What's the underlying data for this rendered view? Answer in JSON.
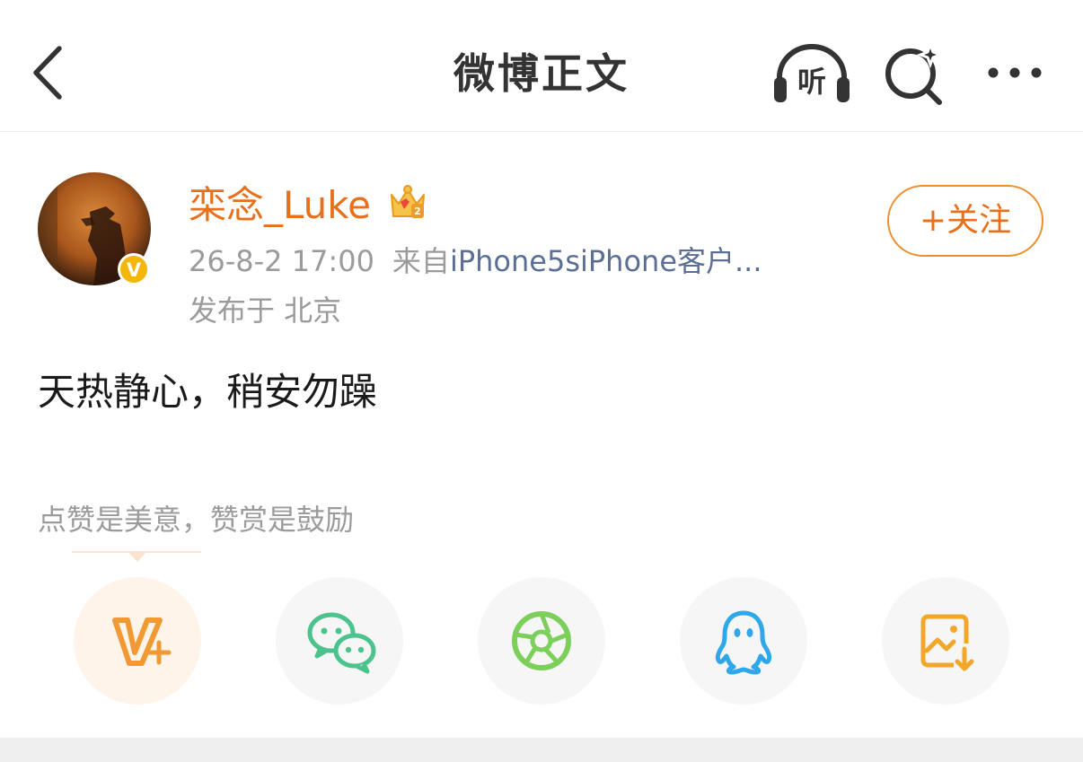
{
  "header": {
    "title": "微博正文",
    "listen_label": "听",
    "back_icon": "chevron-left-icon",
    "search_icon": "search-sparkle-icon",
    "more_icon": "more-dots-icon"
  },
  "author": {
    "name": "栾念_Luke",
    "verified_mark": "V",
    "timestamp": "26-8-2 17:00",
    "source_prefix": "来自",
    "source_name": "iPhone5siPhone客户...",
    "location": "发布于 北京",
    "follow_label": "+关注"
  },
  "post": {
    "text": "天热静心，稍安勿躁"
  },
  "reward": {
    "caption": "点赞是美意，赞赏是鼓励"
  },
  "share_buttons": [
    {
      "icon": "reward-v-plus-icon",
      "color": "#f19a33"
    },
    {
      "icon": "wechat-icon",
      "color": "#4cc28d"
    },
    {
      "icon": "moments-icon",
      "color": "#7ccf5b"
    },
    {
      "icon": "qq-icon",
      "color": "#30a7ea"
    },
    {
      "icon": "save-image-icon",
      "color": "#f2a62a"
    }
  ],
  "colors": {
    "accent": "#e8701a",
    "link": "#5b6f96",
    "secondary_text": "#9b9b9b"
  }
}
